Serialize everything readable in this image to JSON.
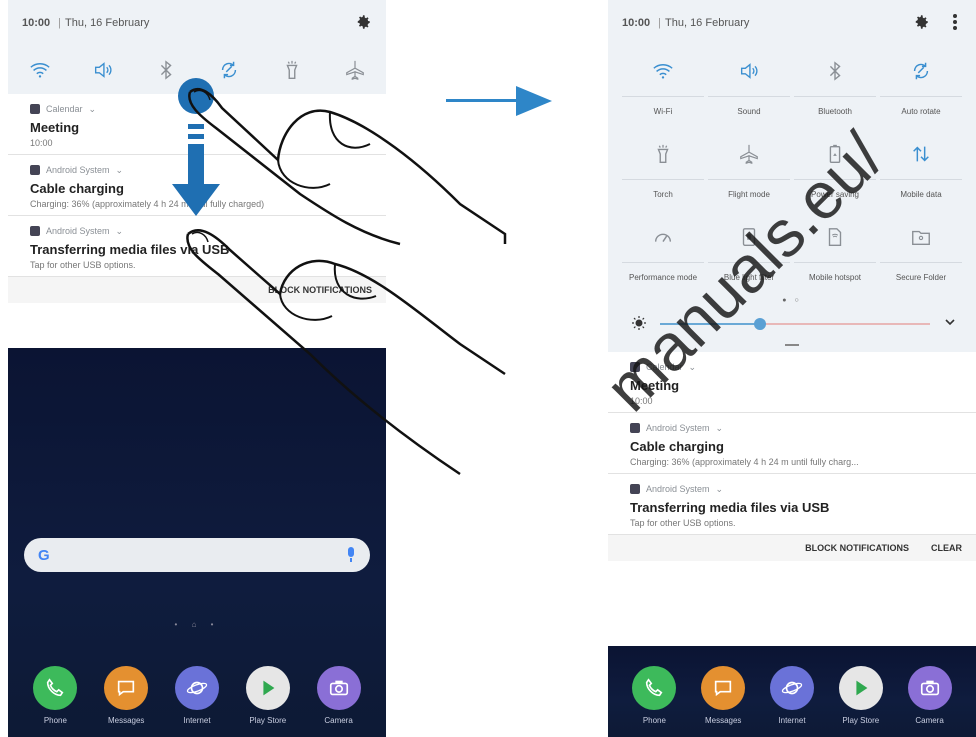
{
  "left_panel": {
    "status_bar": {
      "time": "10:00",
      "date": "Thu, 16 February"
    },
    "quick_icons": [
      {
        "name": "wifi",
        "active": true
      },
      {
        "name": "sound",
        "active": true
      },
      {
        "name": "bluetooth",
        "active": false
      },
      {
        "name": "auto-rotate",
        "active": true
      },
      {
        "name": "torch",
        "active": false
      },
      {
        "name": "airplane",
        "active": false
      }
    ],
    "notifications": [
      {
        "app": "Calendar",
        "title": "Meeting",
        "body": "10:00"
      },
      {
        "app": "Android System",
        "title": "Cable charging",
        "body": "Charging: 36% (approximately 4 h 24 m until fully charged)"
      },
      {
        "app": "Android System",
        "title": "Transferring media files via USB",
        "body": "Tap for other USB options."
      }
    ],
    "actions": {
      "block": "BLOCK NOTIFICATIONS"
    },
    "search_letter": "G",
    "dock": [
      {
        "label": "Phone",
        "color": "#3dba5b"
      },
      {
        "label": "Messages",
        "color": "#e49030"
      },
      {
        "label": "Internet",
        "color": "#6a72d8"
      },
      {
        "label": "Play Store",
        "color": "#e6e6e6"
      },
      {
        "label": "Camera",
        "color": "#8a6fd6"
      }
    ]
  },
  "right_panel": {
    "status_bar": {
      "time": "10:00",
      "date": "Thu, 16 February"
    },
    "tiles": [
      [
        {
          "icon": "wifi",
          "label": "Wi-Fi",
          "active": true
        },
        {
          "icon": "sound",
          "label": "Sound",
          "active": true
        },
        {
          "icon": "bluetooth",
          "label": "Bluetooth",
          "active": false
        },
        {
          "icon": "auto-rotate",
          "label": "Auto rotate",
          "active": true
        }
      ],
      [
        {
          "icon": "torch",
          "label": "Torch",
          "active": false
        },
        {
          "icon": "airplane",
          "label": "Flight mode",
          "active": false
        },
        {
          "icon": "power-saving",
          "label": "Power saving",
          "active": false
        },
        {
          "icon": "mobile-data",
          "label": "Mobile data",
          "active": true
        }
      ],
      [
        {
          "icon": "performance",
          "label": "Performance mode",
          "active": false
        },
        {
          "icon": "blue-light",
          "label": "Blue light filter",
          "active": false
        },
        {
          "icon": "hotspot",
          "label": "Mobile hotspot",
          "active": false
        },
        {
          "icon": "secure-folder",
          "label": "Secure Folder",
          "active": false
        }
      ]
    ],
    "brightness_level": 0.37,
    "notifications": [
      {
        "app": "Calendar",
        "title": "Meeting",
        "body": "10:00"
      },
      {
        "app": "Android System",
        "title": "Cable charging",
        "body": "Charging: 36% (approximately 4 h 24 m until fully charg..."
      },
      {
        "app": "Android System",
        "title": "Transferring media files via USB",
        "body": "Tap for other USB options."
      }
    ],
    "actions": {
      "block": "BLOCK NOTIFICATIONS",
      "clear": "CLEAR"
    },
    "dock": [
      {
        "label": "Phone",
        "color": "#3dba5b"
      },
      {
        "label": "Messages",
        "color": "#e49030"
      },
      {
        "label": "Internet",
        "color": "#6a72d8"
      },
      {
        "label": "Play Store",
        "color": "#e6e6e6"
      },
      {
        "label": "Camera",
        "color": "#8a6fd6"
      }
    ]
  },
  "watermark": "manuals.eu/",
  "colors": {
    "accent": "#2e86c8",
    "arrow": "#2e86c8"
  }
}
